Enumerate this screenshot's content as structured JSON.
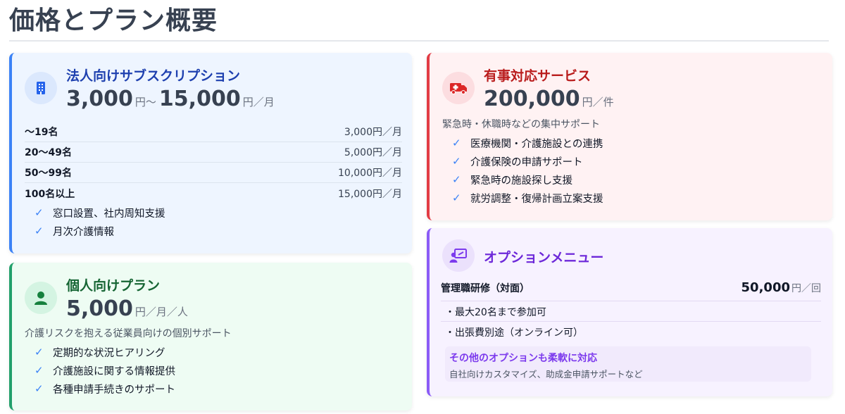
{
  "page": {
    "title": "価格とプラン概要"
  },
  "corporate": {
    "name": "法人向けサブスクリプション",
    "price_min": "3,000",
    "price_min_unit": "円〜",
    "price_max": "15,000",
    "price_max_unit": "円／月",
    "tiers": [
      {
        "label": "〜19名",
        "price": "3,000円／月"
      },
      {
        "label": "20〜49名",
        "price": "5,000円／月"
      },
      {
        "label": "50〜99名",
        "price": "10,000円／月"
      },
      {
        "label": "100名以上",
        "price": "15,000円／月"
      }
    ],
    "features": [
      "窓口設置、社内周知支援",
      "月次介護情報"
    ],
    "accent": "#3b82f6",
    "icon": "building-icon"
  },
  "individual": {
    "name": "個人向けプラン",
    "price": "5,000",
    "price_unit": "円／月／人",
    "description": "介護リスクを抱える従業員向けの個別サポート",
    "features": [
      "定期的な状況ヒアリング",
      "介護施設に関する情報提供",
      "各種申請手続きのサポート"
    ],
    "accent": "#22a06b",
    "icon": "person-icon"
  },
  "emergency": {
    "name": "有事対応サービス",
    "price": "200,000",
    "price_unit": "円／件",
    "description": "緊急時・休職時などの集中サポート",
    "features": [
      "医療機関・介護施設との連携",
      "介護保険の申請サポート",
      "緊急時の施設探し支援",
      "就労調整・復帰計画立案支援"
    ],
    "accent": "#e23c45",
    "icon": "ambulance-icon"
  },
  "options": {
    "name": "オプションメニュー",
    "item_name": "管理職研修（対面）",
    "item_price": "50,000",
    "item_price_unit": "円／回",
    "bullets": [
      "・最大20名まで参加可",
      "・出張費別途（オンライン可）"
    ],
    "more_title": "その他のオプションも柔軟に対応",
    "more_desc": "自社向けカスタマイズ、助成金申請サポートなど",
    "accent": "#8b5cf6",
    "icon": "presentation-icon"
  },
  "check_icon": "✓"
}
